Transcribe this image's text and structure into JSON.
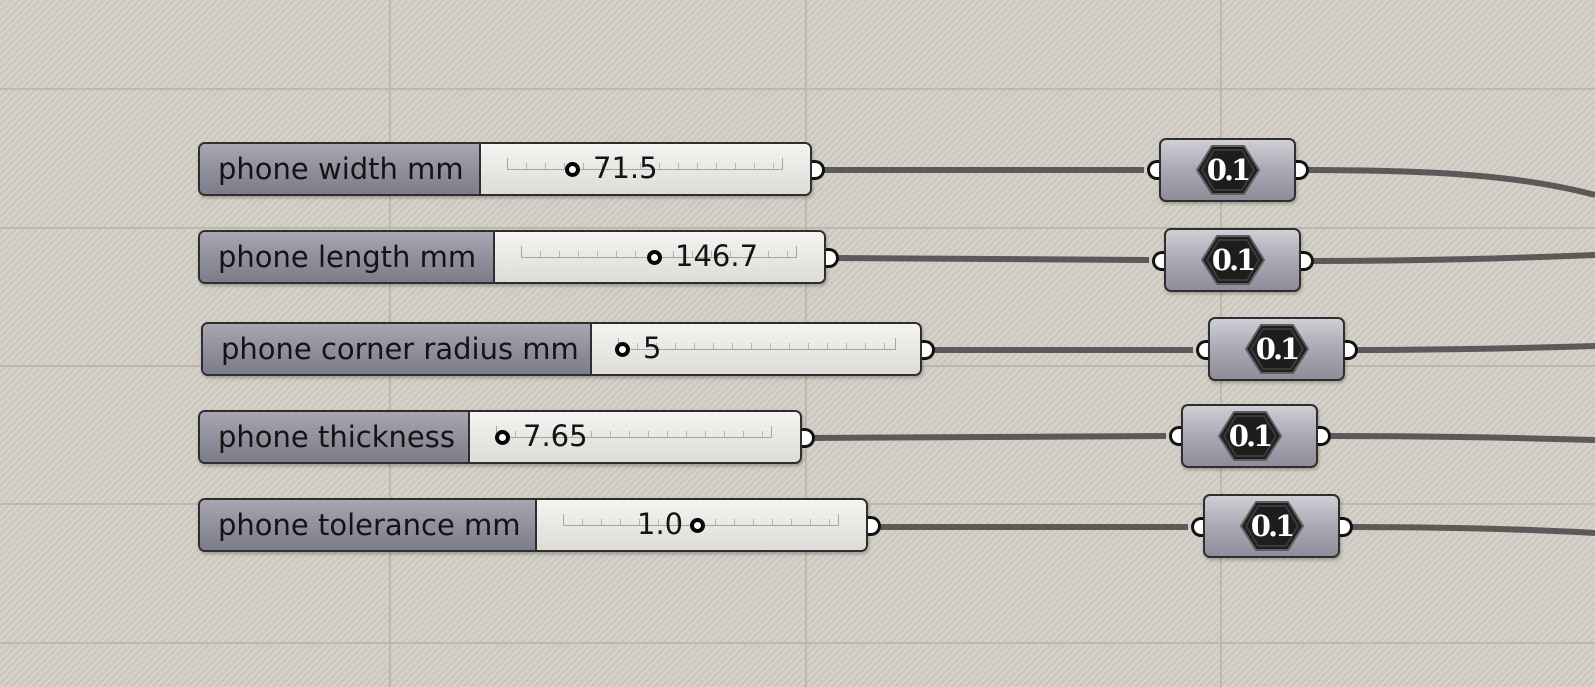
{
  "sliders": [
    {
      "label": "phone width mm",
      "value": "71.5"
    },
    {
      "label": "phone length mm",
      "value": "146.7"
    },
    {
      "label": "phone corner radius mm",
      "value": "5"
    },
    {
      "label": "phone thickness",
      "value": "7.65"
    },
    {
      "label": "phone tolerance mm",
      "value": "1.0"
    }
  ],
  "panels": [
    {
      "icon": "number-hexagon-icon",
      "text": "0.1"
    },
    {
      "icon": "number-hexagon-icon",
      "text": "0.1"
    },
    {
      "icon": "number-hexagon-icon",
      "text": "0.1"
    },
    {
      "icon": "number-hexagon-icon",
      "text": "0.1"
    },
    {
      "icon": "number-hexagon-icon",
      "text": "0.1"
    }
  ],
  "colors": {
    "canvas": "#d3cfc6",
    "wire": "#5a5a58",
    "label_fill": "#8f8e9b"
  }
}
